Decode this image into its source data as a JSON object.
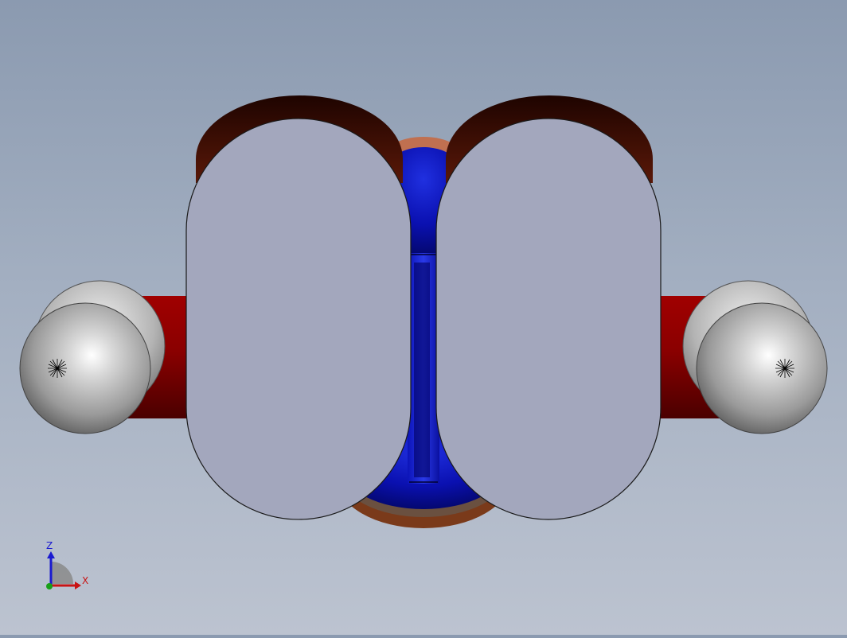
{
  "viewport": {
    "background_top": "#8b9ab0",
    "background_bottom": "#bcc3d0"
  },
  "model": {
    "plate_color": "#a3a7bd",
    "core_color": "#0a0fb0",
    "rod_color": "#8e0000",
    "sphere_color": "#b8b8b8",
    "rim_color": "#2a0a00"
  },
  "triad": {
    "z_label": "Z",
    "x_label": "X",
    "z_color": "#1a1ad0",
    "x_color": "#c81414",
    "y_color": "#18a018"
  }
}
